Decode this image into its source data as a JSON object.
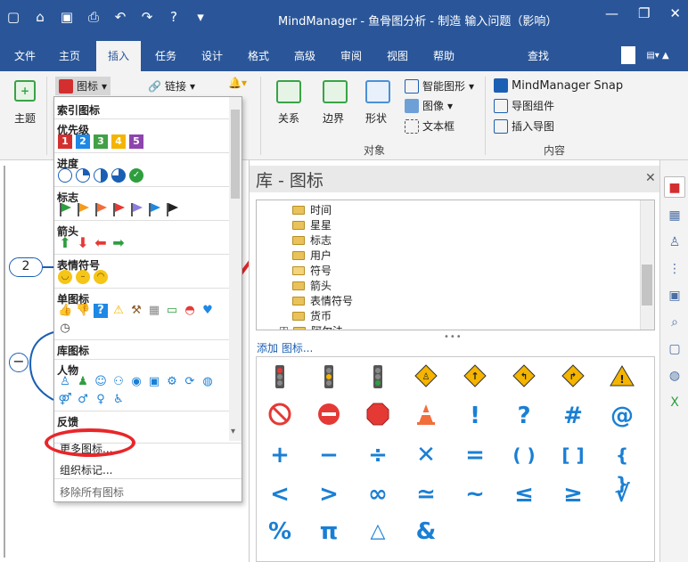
{
  "window": {
    "title": "MindManager - 鱼骨图分析 - 制造 输入问题（影响）",
    "qat_icons": [
      "new-icon",
      "open-icon",
      "save-icon",
      "print-icon",
      "undo-icon",
      "redo-icon",
      "help-icon",
      "customize-icon"
    ]
  },
  "tabs": [
    {
      "label": "文件"
    },
    {
      "label": "主页"
    },
    {
      "label": "插入"
    },
    {
      "label": "任务"
    },
    {
      "label": "设计"
    },
    {
      "label": "格式"
    },
    {
      "label": "高级"
    },
    {
      "label": "审阅"
    },
    {
      "label": "视图"
    },
    {
      "label": "帮助"
    },
    {
      "label": "查找"
    }
  ],
  "ribbon": {
    "topic_label": "主题",
    "icons_label": "图标",
    "link_label": "链接",
    "relation_label": "关系",
    "boundary_label": "边界",
    "shape_label": "形状",
    "smart_shape_label": "智能图形",
    "image_label": "图像",
    "textbox_label": "文本框",
    "objects_group": "对象",
    "snap_label": "MindManager Snap",
    "map_parts_label": "导图组件",
    "insert_map_label": "插入导图",
    "content_group": "内容"
  },
  "menu": {
    "index_icons": "索引图标",
    "priority": "优先级",
    "priority_items": [
      "1",
      "2",
      "3",
      "4",
      "5"
    ],
    "priority_colors": [
      "#d32f2f",
      "#1e88e5",
      "#43a047",
      "#f4b400",
      "#8e44ad"
    ],
    "progress": "进度",
    "flags": "标志",
    "flag_colors": [
      "#2e9e3e",
      "#f59b1c",
      "#f26d3c",
      "#e53935",
      "#8c7ee0",
      "#1e88e5",
      "#222222"
    ],
    "arrows": "箭头",
    "emoji": "表情符号",
    "single_icons": "单图标",
    "library_icons": "库图标",
    "people": "人物",
    "feedback": "反馈",
    "more_icons": "更多图标...",
    "organize_tags": "组织标记...",
    "remove_all": "移除所有图标"
  },
  "pane": {
    "title": "库 - 图标",
    "folders": [
      "时间",
      "星星",
      "标志",
      "用户",
      "符号",
      "箭头",
      "表情符号",
      "货币",
      "阿尔法"
    ],
    "add_icons": "添加 图标...",
    "grid_row1_names": [
      "traffic-light-red-icon",
      "traffic-light-yellow-icon",
      "traffic-light-green-icon",
      "pedestrian-sign-icon",
      "arrow-up-sign-icon",
      "merge-left-sign-icon",
      "merge-right-sign-icon",
      "warning-icon"
    ],
    "grid_row2": [
      "⃠",
      "⛔",
      "🛑",
      "🔺",
      "!",
      "?",
      "#",
      "@"
    ],
    "grid_row3": [
      "+",
      "−",
      "÷",
      "✕",
      "=",
      "( )",
      "[ ]",
      "{ }"
    ],
    "grid_row4": [
      "<",
      ">",
      "∞",
      "≃",
      "~",
      "≤",
      "≥",
      "√"
    ],
    "grid_row5": [
      "%",
      "π",
      "△",
      "&"
    ]
  },
  "canvas": {
    "node_label": "2"
  }
}
